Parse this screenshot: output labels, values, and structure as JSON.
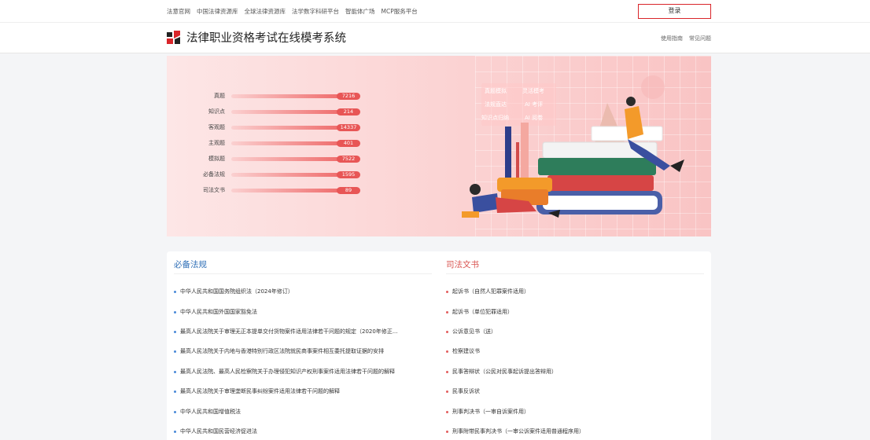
{
  "topnav": {
    "links": [
      "法意官网",
      "中国法律资源库",
      "全球法律资源库",
      "法学数字科研平台",
      "智能体广场",
      "MCP服务平台"
    ],
    "login": "登录"
  },
  "header": {
    "title": "法律职业资格考试在线模考系统",
    "links": [
      "使用指南",
      "常见问题"
    ]
  },
  "banner": {
    "stats": [
      {
        "label": "真题",
        "value": "7216"
      },
      {
        "label": "知识点",
        "value": "214"
      },
      {
        "label": "客观题",
        "value": "14337"
      },
      {
        "label": "主观题",
        "value": "401"
      },
      {
        "label": "模拟题",
        "value": "7522"
      },
      {
        "label": "必备法规",
        "value": "1595"
      },
      {
        "label": "司法文书",
        "value": "89"
      }
    ],
    "features": [
      "真题模拟",
      "灵活模考",
      "法规直达",
      "AI 考评",
      "知识点归纳",
      "AI 阅卷"
    ]
  },
  "laws": {
    "title": "必备法规",
    "items": [
      "中华人民共和国国务院组织法（2024年修订）",
      "中华人民共和国外国国家豁免法",
      "最高人民法院关于审理无正本提单交付货物案件适用法律若干问题的规定（2020年修正...",
      "最高人民法院关于内地与香港特别行政区法院就民商事案件相互委托提取证据的安排",
      "最高人民法院、最高人民检察院关于办理侵犯知识产权刑事案件适用法律若干问题的解释",
      "最高人民法院关于审理垄断民事纠纷案件适用法律若干问题的解释",
      "中华人民共和国增值税法",
      "中华人民共和国民营经济促进法"
    ]
  },
  "docs": {
    "title": "司法文书",
    "items": [
      "起诉书（自然人犯罪案件适用）",
      "起诉书（单位犯罪适用）",
      "公诉意见书（送）",
      "检察建议书",
      "民事答辩状（公民对民事起诉提出答辩用）",
      "民事反诉状",
      "刑事判决书（一审自诉案件用）",
      "刑事附带民事判决书（一审公诉案件适用普通程序用）"
    ]
  },
  "colors": {
    "accent_red": "#d9252a",
    "blue_title": "#2f6fb7",
    "red_title": "#d9534f"
  }
}
